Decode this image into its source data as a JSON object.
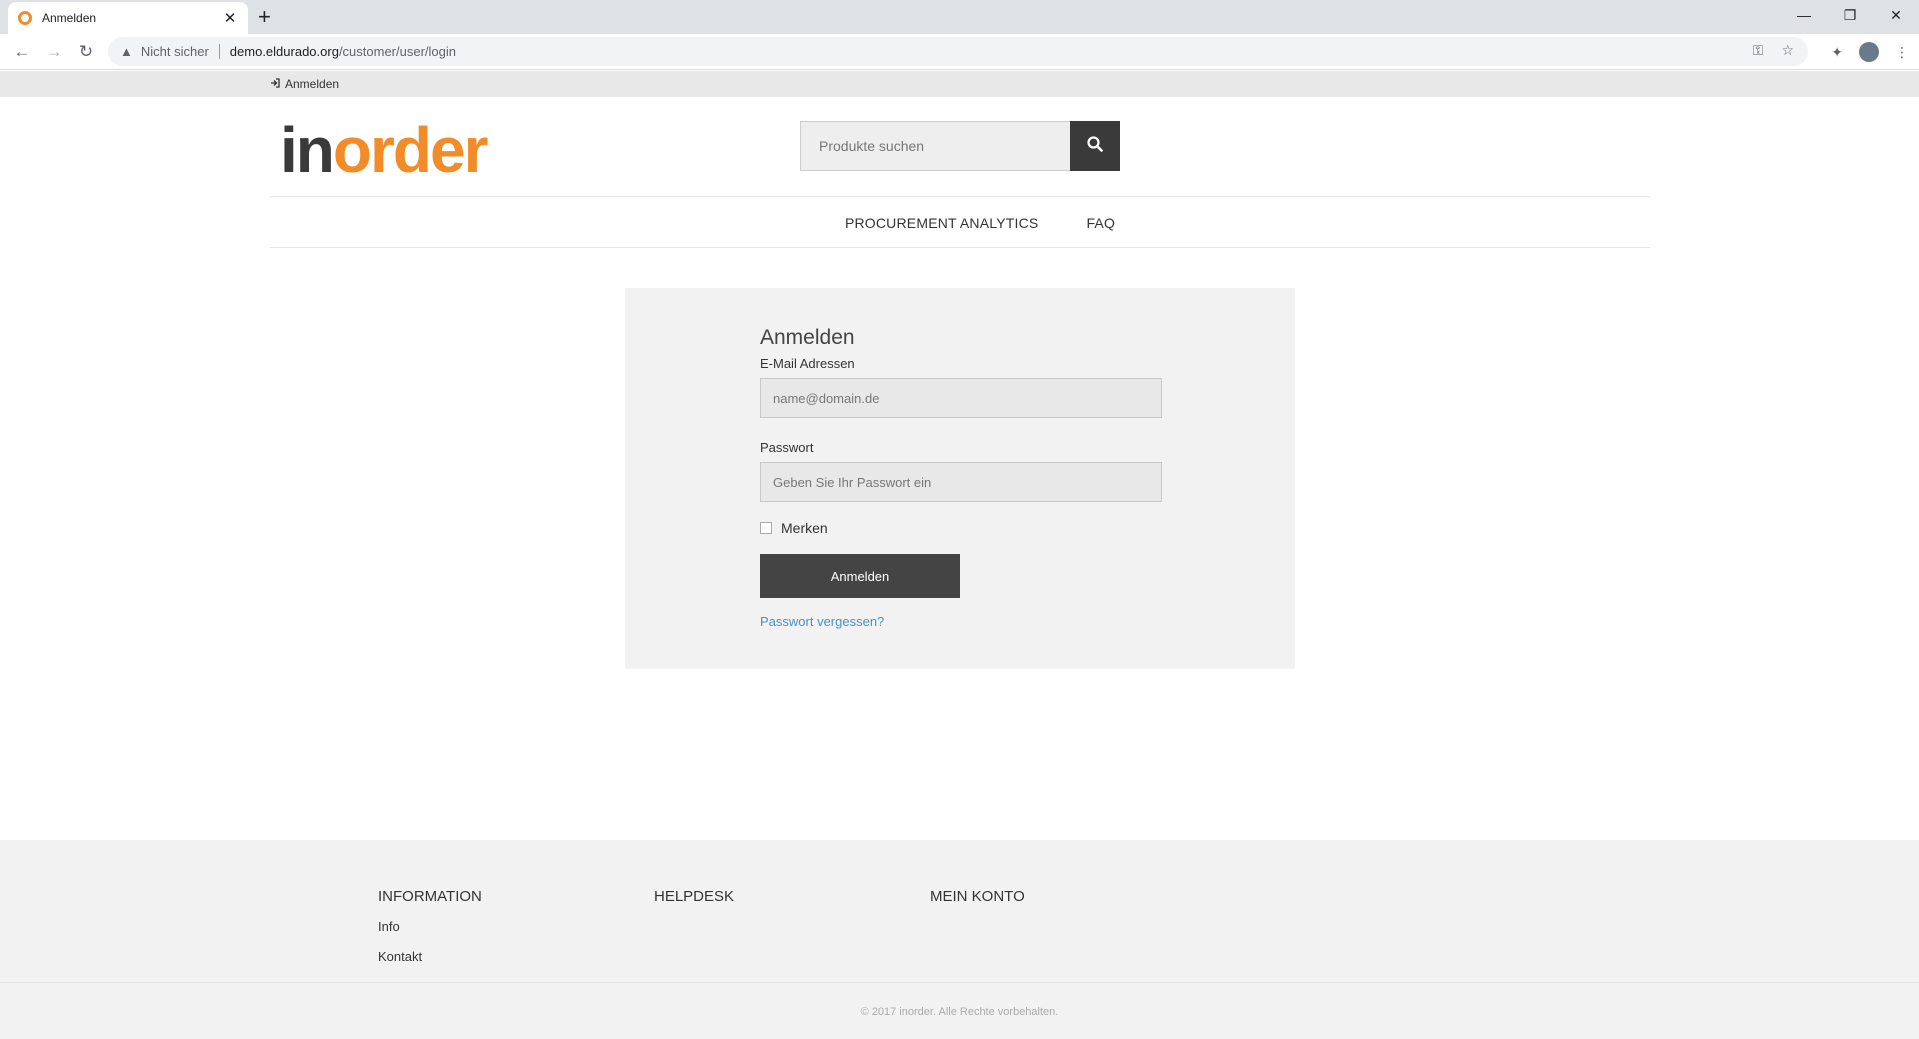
{
  "browser": {
    "tab_title": "Anmelden",
    "not_secure": "Nicht sicher",
    "url_host": "demo.eldurado.org",
    "url_path": "/customer/user/login"
  },
  "topbar": {
    "login_link": "Anmelden"
  },
  "logo": {
    "part1": "in",
    "part2": "order"
  },
  "search": {
    "placeholder": "Produkte suchen"
  },
  "nav": {
    "items": [
      "PROCUREMENT ANALYTICS",
      "FAQ"
    ]
  },
  "login": {
    "title": "Anmelden",
    "email_label": "E-Mail Adressen",
    "email_placeholder": "name@domain.de",
    "password_label": "Passwort",
    "password_placeholder": "Geben Sie Ihr Passwort ein",
    "remember_label": "Merken",
    "submit_label": "Anmelden",
    "forgot_link": "Passwort vergessen?"
  },
  "footer": {
    "col1_title": "INFORMATION",
    "col1_links": [
      "Info",
      "Kontakt"
    ],
    "col2_title": "HELPDESK",
    "col3_title": "MEIN KONTO",
    "copyright": "© 2017 inorder. Alle Rechte vorbehalten."
  },
  "colors": {
    "brand_orange": "#f28c28",
    "dark": "#3a3a3a",
    "link_blue": "#4a90c2"
  }
}
